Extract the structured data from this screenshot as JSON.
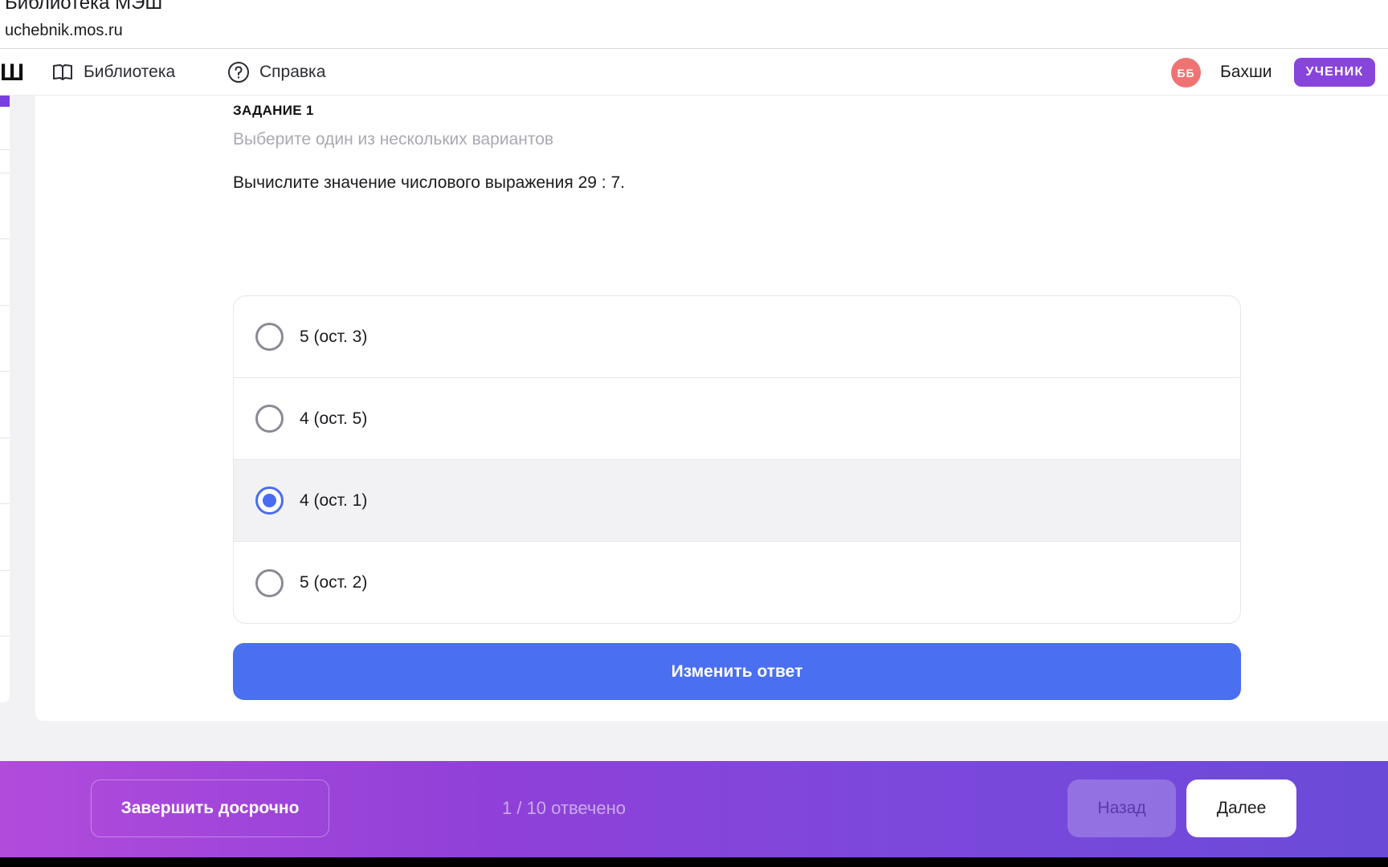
{
  "window": {
    "title": "Библиотека МЭШ",
    "url": "uchebnik.mos.ru"
  },
  "navbar": {
    "logo_fragment": "Ш",
    "items": [
      {
        "label": "Библиотека",
        "icon": "book-icon"
      },
      {
        "label": "Справка",
        "icon": "help-circle-icon"
      }
    ],
    "user": {
      "initials": "ББ",
      "name": "Бахши",
      "role": "УЧЕНИК"
    }
  },
  "task": {
    "label": "ЗАДАНИЕ 1",
    "hint": "Выберите один из нескольких вариантов",
    "question": "Вычислите значение числового выражения 29 : 7.",
    "options": [
      {
        "text": "5 (ост. 3)",
        "selected": false
      },
      {
        "text": "4 (ост. 5)",
        "selected": false
      },
      {
        "text": "4 (ост. 1)",
        "selected": true
      },
      {
        "text": "5 (ост. 2)",
        "selected": false
      }
    ],
    "change_answer_label": "Изменить ответ"
  },
  "footer": {
    "finish_label": "Завершить досрочно",
    "progress": "1 / 10 отвечено",
    "back_label": "Назад",
    "next_label": "Далее"
  },
  "colors": {
    "accent_blue": "#4a6ff0",
    "role_badge": "#8845dc",
    "avatar": "#f07373",
    "footer_gradient_start": "#b24bdc",
    "footer_gradient_end": "#6b4ad8"
  }
}
